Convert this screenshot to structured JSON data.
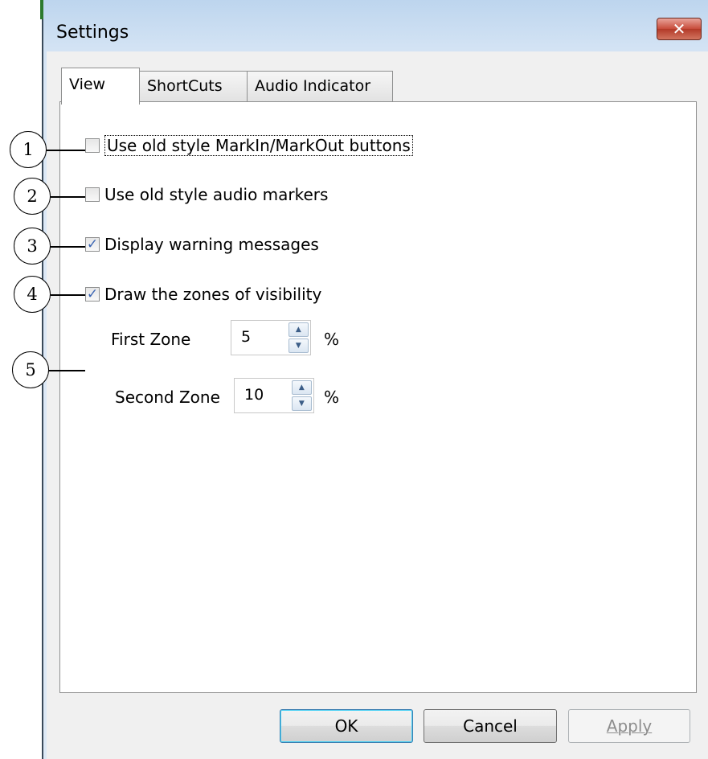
{
  "window": {
    "title": "Settings",
    "close_glyph": "✕"
  },
  "tabs": [
    {
      "label": "View",
      "active": true
    },
    {
      "label": "ShortCuts",
      "active": false
    },
    {
      "label": "Audio Indicator",
      "active": false
    }
  ],
  "options": [
    {
      "label": "Use old style MarkIn/MarkOut buttons",
      "checked": false
    },
    {
      "label": "Use old style audio markers",
      "checked": false
    },
    {
      "label": "Display warning messages",
      "checked": true
    },
    {
      "label": "Draw the zones of visibility",
      "checked": true
    }
  ],
  "zones": {
    "first": {
      "label": "First Zone",
      "value": "5",
      "unit": "%"
    },
    "second": {
      "label": "Second Zone",
      "value": "10",
      "unit": "%"
    }
  },
  "buttons": {
    "ok": "OK",
    "cancel": "Cancel",
    "apply": "Apply"
  },
  "callouts": [
    "1",
    "2",
    "3",
    "4",
    "5"
  ],
  "glyphs": {
    "check": "✓",
    "up": "▲",
    "down": "▼"
  }
}
